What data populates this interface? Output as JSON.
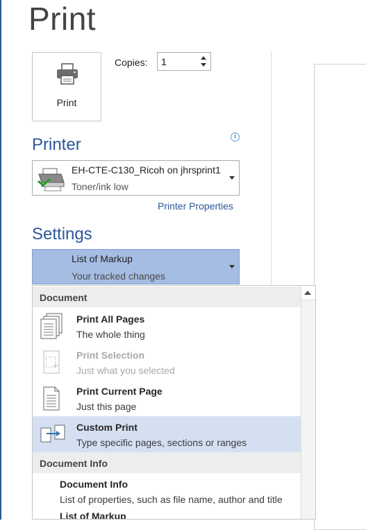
{
  "page": {
    "title": "Print"
  },
  "print_button": {
    "label": "Print",
    "icon": "printer-icon"
  },
  "copies": {
    "label": "Copies:",
    "value": "1"
  },
  "printer": {
    "heading": "Printer",
    "name": "EH-CTE-C130_Ricoh on jhrsprint1",
    "status": "Toner/ink low",
    "properties_link": "Printer Properties",
    "info_icon": "info-icon"
  },
  "settings": {
    "heading": "Settings",
    "selected_title": "List of Markup",
    "selected_subtitle": "Your tracked changes"
  },
  "menu": {
    "group1": "Document",
    "items": [
      {
        "title": "Print All Pages",
        "subtitle": "The whole thing",
        "icon": "pages-stack-icon"
      },
      {
        "title": "Print Selection",
        "subtitle": "Just what you selected",
        "icon": "selection-page-icon"
      },
      {
        "title": "Print Current Page",
        "subtitle": "Just this page",
        "icon": "single-page-icon"
      },
      {
        "title": "Custom Print",
        "subtitle": "Type specific pages, sections or ranges",
        "icon": "custom-pages-icon"
      }
    ],
    "group2": "Document Info",
    "info_items": [
      {
        "title": "Document Info",
        "subtitle": "List of properties, such as file name, author and title"
      },
      {
        "title": "List of Markup"
      }
    ]
  },
  "colors": {
    "accent": "#2b579a",
    "selected": "#a5bde3",
    "hover": "#d4e0f2"
  }
}
